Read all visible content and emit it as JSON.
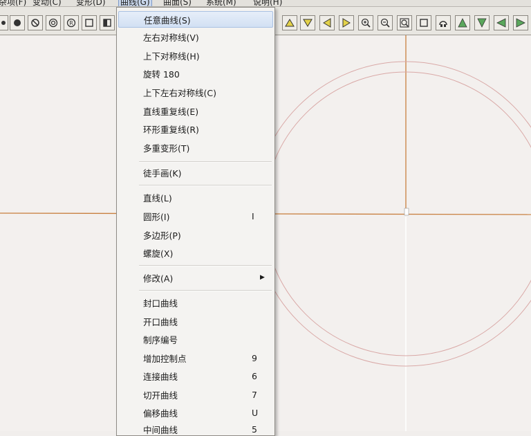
{
  "menubar": {
    "items": [
      "杂项(F)",
      "变动(C)",
      "变形(D)",
      "曲线(G)",
      "曲面(S)",
      "系统(M)",
      "说明(H)"
    ],
    "active_index": 3
  },
  "toolbar": {
    "left_icons": [
      "filled-circle-icon",
      "circle-slash-icon",
      "ring-icon",
      "circle-r-icon",
      "square-icon",
      "half-square-icon",
      "corner-square-icon"
    ],
    "right_icons": [
      "triangle-up-icon",
      "triangle-down-icon",
      "triangle-left-icon",
      "triangle-right-icon",
      "zoom-in-icon",
      "zoom-out-icon",
      "zoom-fit-icon",
      "window-icon",
      "rotate-view-icon",
      "arrow-up-icon",
      "arrow-down-icon",
      "arrow-left-icon",
      "arrow-right-icon"
    ]
  },
  "menu": {
    "items": [
      {
        "label": "任意曲线(S)",
        "key": "",
        "submenu": false,
        "highlighted": true
      },
      {
        "label": "左右对称线(V)",
        "key": ""
      },
      {
        "label": "上下对称线(H)",
        "key": ""
      },
      {
        "label": "旋转 180",
        "key": ""
      },
      {
        "label": "上下左右对称线(C)",
        "key": ""
      },
      {
        "label": "直线重复线(E)",
        "key": ""
      },
      {
        "label": "环形重复线(R)",
        "key": ""
      },
      {
        "label": "多重变形(T)",
        "key": ""
      },
      {
        "label": "徒手画(K)",
        "key": ""
      },
      {
        "label": "直线(L)",
        "key": ""
      },
      {
        "label": "圆形(I)",
        "key": "I"
      },
      {
        "label": "多边形(P)",
        "key": ""
      },
      {
        "label": "螺旋(X)",
        "key": ""
      },
      {
        "label": "修改(A)",
        "key": "",
        "submenu": true
      },
      {
        "label": "封口曲线",
        "key": ""
      },
      {
        "label": "开口曲线",
        "key": ""
      },
      {
        "label": "制序编号",
        "key": ""
      },
      {
        "label": "增加控制点",
        "key": "9"
      },
      {
        "label": "连接曲线",
        "key": "6"
      },
      {
        "label": "切开曲线",
        "key": "7"
      },
      {
        "label": "偏移曲线",
        "key": "U"
      },
      {
        "label": "中间曲线",
        "key": "5"
      }
    ]
  },
  "colors": {
    "canvas_bg": "#f3f0ee",
    "axis_line": "#c87f3e",
    "circle_line": "#d9a8a6",
    "menu_highlight": "#d2e0f3"
  }
}
